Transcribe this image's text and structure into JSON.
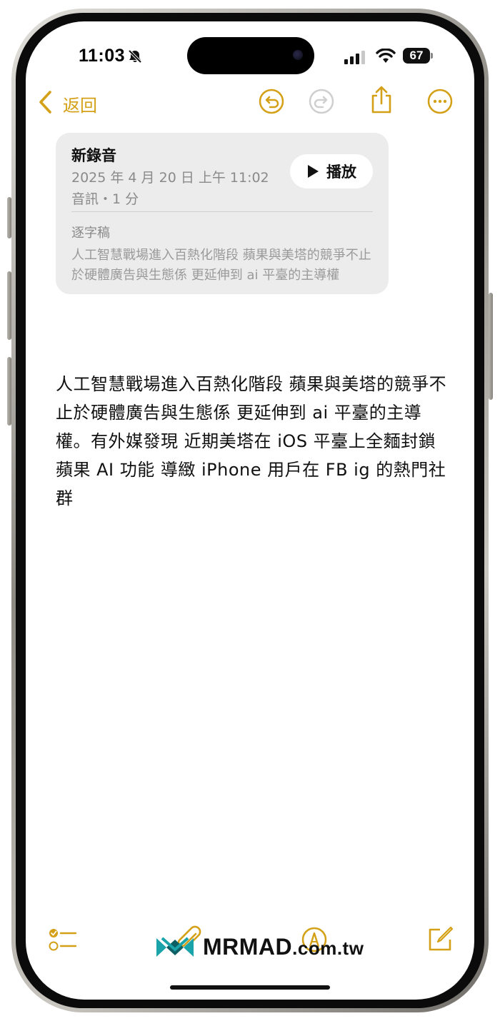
{
  "status_bar": {
    "time": "11:03",
    "battery": "67",
    "icons": [
      "bell-slash-icon",
      "cellular-signal-icon",
      "wifi-icon",
      "battery-icon"
    ]
  },
  "nav": {
    "back_label": "返回",
    "icons": [
      "chevron-left-icon",
      "undo-icon",
      "redo-icon",
      "share-icon",
      "more-icon"
    ]
  },
  "audio_card": {
    "title": "新錄音",
    "date": "2025 年 4 月 20 日 上午 11:02",
    "meta": "音訊・1 分",
    "play_label": "播放",
    "transcript_label": "逐字稿",
    "transcript_excerpt": "人工智慧戰場進入百熱化階段 蘋果與美塔的競爭不止於硬體廣告與生態係 更延伸到 ai 平臺的主導權"
  },
  "note": {
    "body": "人工智慧戰場進入百熱化階段 蘋果與美塔的競爭不止於硬體廣告與生態係 更延伸到 ai 平臺的主導權。有外媒發現 近期美塔在 iOS 平臺上全麵封鎖 蘋果 AI 功能 導緻 iPhone 用戶在 FB ig 的熱門社群"
  },
  "toolbar": {
    "icons": [
      "checklist-icon",
      "paperclip-icon",
      "markup-pen-icon",
      "compose-icon"
    ]
  },
  "watermark": {
    "brand": "MRMAD",
    "domain": ".com.tw"
  },
  "colors": {
    "accent": "#d4a017",
    "card_bg": "#ececec",
    "watermark_teal": "#1aa3a8"
  }
}
